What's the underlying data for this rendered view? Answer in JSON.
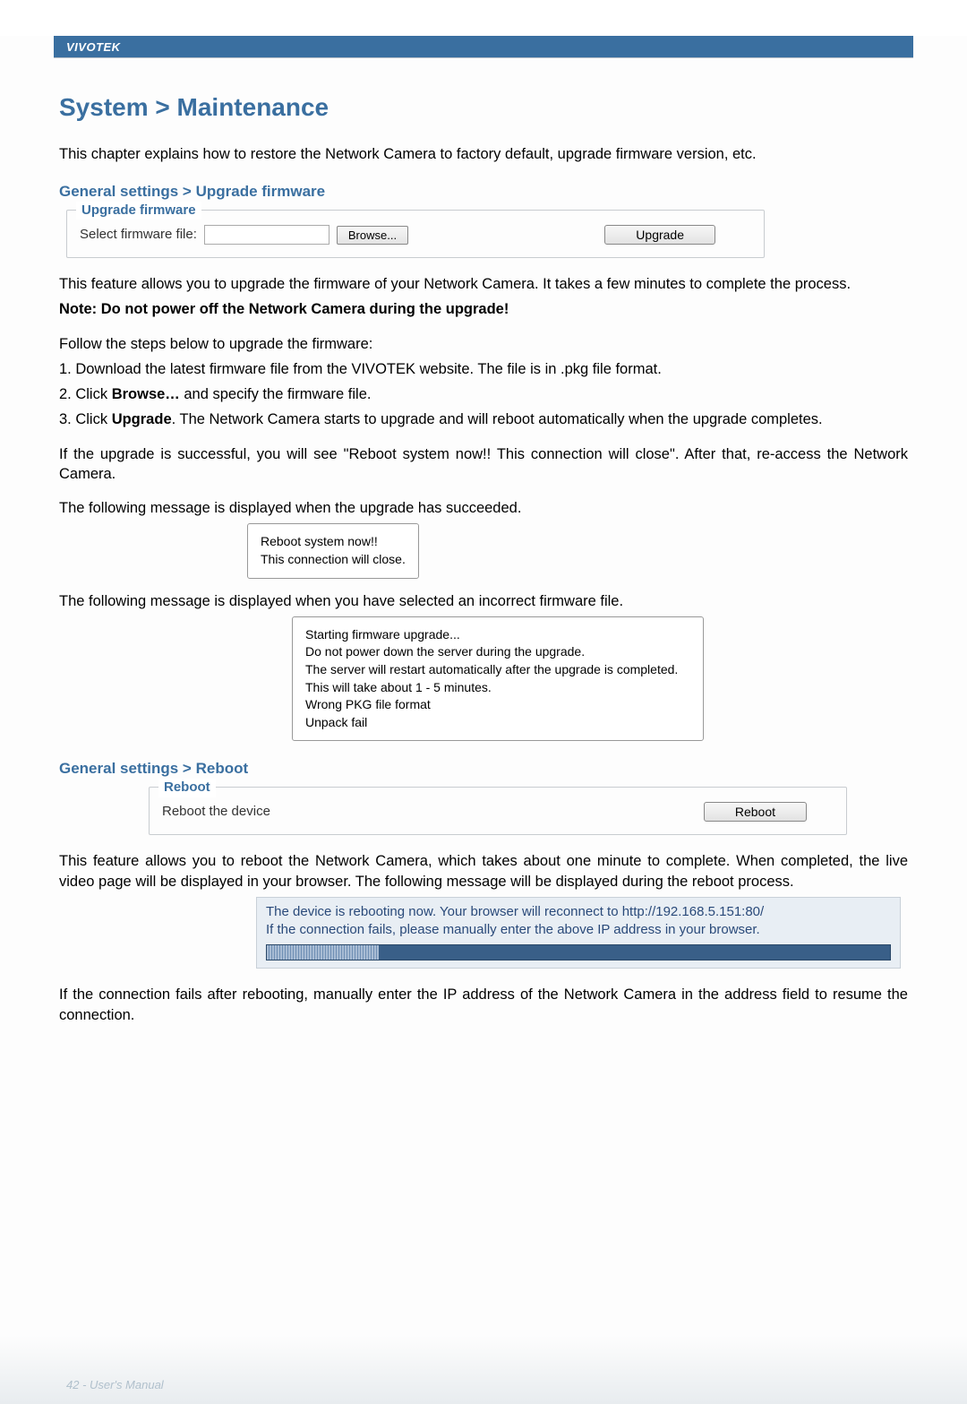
{
  "brand": "VIVOTEK",
  "title": "System > Maintenance",
  "intro": "This chapter explains how to restore the Network Camera to factory default, upgrade firmware version, etc.",
  "section_upgrade": {
    "heading": "General settings > Upgrade firmware",
    "legend": "Upgrade firmware",
    "label": "Select firmware file:",
    "browse": "Browse...",
    "upgrade": "Upgrade"
  },
  "upgrade_text": {
    "p1": "This feature allows you to upgrade the firmware of your Network Camera. It takes a few minutes to complete the process.",
    "note": "Note: Do not power off the Network Camera during the upgrade!",
    "steps_intro": "Follow the steps below to upgrade the firmware:",
    "step1": "1. Download the latest firmware file from the VIVOTEK website. The file is in .pkg file format.",
    "step2a": "2. Click ",
    "step2b": "Browse…",
    "step2c": " and specify the firmware file.",
    "step3a": "3. Click ",
    "step3b": "Upgrade",
    "step3c": ". The Network Camera starts to upgrade and will reboot automatically when the upgrade completes.",
    "success": "If the upgrade is successful, you will see \"Reboot system now!! This connection will close\". After that, re-access the Network Camera.",
    "msg_succeeded_intro": "The following message is displayed when the upgrade has succeeded.",
    "msg_succeeded_l1": "Reboot system now!!",
    "msg_succeeded_l2": "This connection will close.",
    "msg_wrong_intro": "The following message is displayed when you have selected an incorrect firmware file.",
    "msg_wrong_l1": "Starting firmware upgrade...",
    "msg_wrong_l2": "Do not power down the server during the upgrade.",
    "msg_wrong_l3": "The server will restart automatically after the upgrade is completed.",
    "msg_wrong_l4": "This will take about 1 - 5 minutes.",
    "msg_wrong_l5": "Wrong PKG file format",
    "msg_wrong_l6": "Unpack fail"
  },
  "section_reboot": {
    "heading": "General settings > Reboot",
    "legend": "Reboot",
    "label": "Reboot the device",
    "button": "Reboot"
  },
  "reboot_text": {
    "p1": "This feature allows you to reboot the Network Camera, which takes about one minute to complete. When completed, the live video page will be displayed in your browser. The following message will be displayed during the reboot process.",
    "msg_l1": "The device is rebooting now. Your browser will reconnect to http://192.168.5.151:80/",
    "msg_l2": "If the connection fails, please manually enter the above IP address in your browser.",
    "p2": "If the connection fails after rebooting, manually enter the IP address of the Network Camera in the address field to resume the connection."
  },
  "footer": "42 - User's Manual"
}
